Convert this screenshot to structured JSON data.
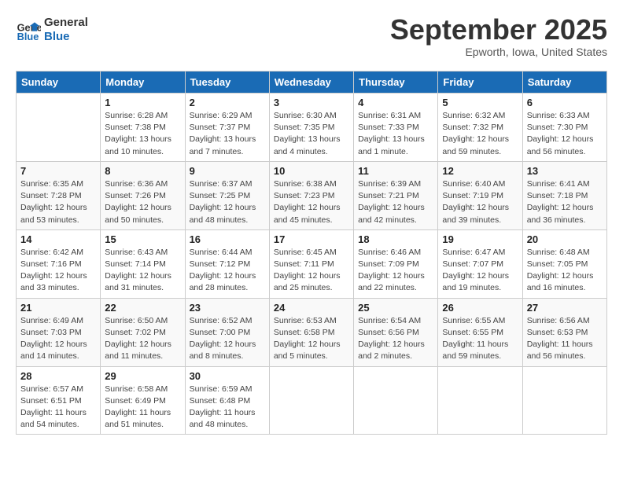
{
  "logo": {
    "line1": "General",
    "line2": "Blue"
  },
  "title": "September 2025",
  "location": "Epworth, Iowa, United States",
  "days_of_week": [
    "Sunday",
    "Monday",
    "Tuesday",
    "Wednesday",
    "Thursday",
    "Friday",
    "Saturday"
  ],
  "weeks": [
    [
      {
        "num": "",
        "info": ""
      },
      {
        "num": "1",
        "info": "Sunrise: 6:28 AM\nSunset: 7:38 PM\nDaylight: 13 hours\nand 10 minutes."
      },
      {
        "num": "2",
        "info": "Sunrise: 6:29 AM\nSunset: 7:37 PM\nDaylight: 13 hours\nand 7 minutes."
      },
      {
        "num": "3",
        "info": "Sunrise: 6:30 AM\nSunset: 7:35 PM\nDaylight: 13 hours\nand 4 minutes."
      },
      {
        "num": "4",
        "info": "Sunrise: 6:31 AM\nSunset: 7:33 PM\nDaylight: 13 hours\nand 1 minute."
      },
      {
        "num": "5",
        "info": "Sunrise: 6:32 AM\nSunset: 7:32 PM\nDaylight: 12 hours\nand 59 minutes."
      },
      {
        "num": "6",
        "info": "Sunrise: 6:33 AM\nSunset: 7:30 PM\nDaylight: 12 hours\nand 56 minutes."
      }
    ],
    [
      {
        "num": "7",
        "info": "Sunrise: 6:35 AM\nSunset: 7:28 PM\nDaylight: 12 hours\nand 53 minutes."
      },
      {
        "num": "8",
        "info": "Sunrise: 6:36 AM\nSunset: 7:26 PM\nDaylight: 12 hours\nand 50 minutes."
      },
      {
        "num": "9",
        "info": "Sunrise: 6:37 AM\nSunset: 7:25 PM\nDaylight: 12 hours\nand 48 minutes."
      },
      {
        "num": "10",
        "info": "Sunrise: 6:38 AM\nSunset: 7:23 PM\nDaylight: 12 hours\nand 45 minutes."
      },
      {
        "num": "11",
        "info": "Sunrise: 6:39 AM\nSunset: 7:21 PM\nDaylight: 12 hours\nand 42 minutes."
      },
      {
        "num": "12",
        "info": "Sunrise: 6:40 AM\nSunset: 7:19 PM\nDaylight: 12 hours\nand 39 minutes."
      },
      {
        "num": "13",
        "info": "Sunrise: 6:41 AM\nSunset: 7:18 PM\nDaylight: 12 hours\nand 36 minutes."
      }
    ],
    [
      {
        "num": "14",
        "info": "Sunrise: 6:42 AM\nSunset: 7:16 PM\nDaylight: 12 hours\nand 33 minutes."
      },
      {
        "num": "15",
        "info": "Sunrise: 6:43 AM\nSunset: 7:14 PM\nDaylight: 12 hours\nand 31 minutes."
      },
      {
        "num": "16",
        "info": "Sunrise: 6:44 AM\nSunset: 7:12 PM\nDaylight: 12 hours\nand 28 minutes."
      },
      {
        "num": "17",
        "info": "Sunrise: 6:45 AM\nSunset: 7:11 PM\nDaylight: 12 hours\nand 25 minutes."
      },
      {
        "num": "18",
        "info": "Sunrise: 6:46 AM\nSunset: 7:09 PM\nDaylight: 12 hours\nand 22 minutes."
      },
      {
        "num": "19",
        "info": "Sunrise: 6:47 AM\nSunset: 7:07 PM\nDaylight: 12 hours\nand 19 minutes."
      },
      {
        "num": "20",
        "info": "Sunrise: 6:48 AM\nSunset: 7:05 PM\nDaylight: 12 hours\nand 16 minutes."
      }
    ],
    [
      {
        "num": "21",
        "info": "Sunrise: 6:49 AM\nSunset: 7:03 PM\nDaylight: 12 hours\nand 14 minutes."
      },
      {
        "num": "22",
        "info": "Sunrise: 6:50 AM\nSunset: 7:02 PM\nDaylight: 12 hours\nand 11 minutes."
      },
      {
        "num": "23",
        "info": "Sunrise: 6:52 AM\nSunset: 7:00 PM\nDaylight: 12 hours\nand 8 minutes."
      },
      {
        "num": "24",
        "info": "Sunrise: 6:53 AM\nSunset: 6:58 PM\nDaylight: 12 hours\nand 5 minutes."
      },
      {
        "num": "25",
        "info": "Sunrise: 6:54 AM\nSunset: 6:56 PM\nDaylight: 12 hours\nand 2 minutes."
      },
      {
        "num": "26",
        "info": "Sunrise: 6:55 AM\nSunset: 6:55 PM\nDaylight: 11 hours\nand 59 minutes."
      },
      {
        "num": "27",
        "info": "Sunrise: 6:56 AM\nSunset: 6:53 PM\nDaylight: 11 hours\nand 56 minutes."
      }
    ],
    [
      {
        "num": "28",
        "info": "Sunrise: 6:57 AM\nSunset: 6:51 PM\nDaylight: 11 hours\nand 54 minutes."
      },
      {
        "num": "29",
        "info": "Sunrise: 6:58 AM\nSunset: 6:49 PM\nDaylight: 11 hours\nand 51 minutes."
      },
      {
        "num": "30",
        "info": "Sunrise: 6:59 AM\nSunset: 6:48 PM\nDaylight: 11 hours\nand 48 minutes."
      },
      {
        "num": "",
        "info": ""
      },
      {
        "num": "",
        "info": ""
      },
      {
        "num": "",
        "info": ""
      },
      {
        "num": "",
        "info": ""
      }
    ]
  ]
}
